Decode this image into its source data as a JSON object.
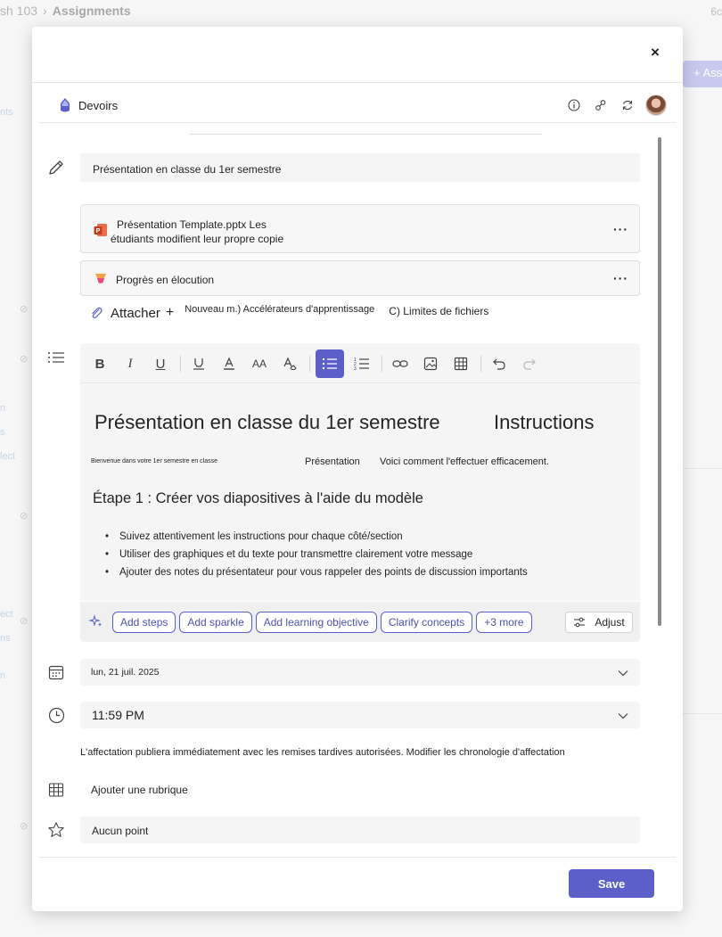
{
  "background": {
    "breadcrumb": [
      "sh 103",
      "Assignments"
    ],
    "top_right": "6c",
    "new_button": "+ Assi",
    "side_labels": [
      "nts",
      "n",
      "s",
      "lect",
      "ect",
      "ns",
      "n"
    ]
  },
  "app_bar": {
    "name": "Devoirs",
    "icons": [
      "info-icon",
      "share-icon",
      "refresh-icon"
    ]
  },
  "title": {
    "value": "Présentation en classe du 1er semestre"
  },
  "attachments": [
    {
      "type": "pptx",
      "line1": "Présentation Template.pptx Les",
      "line2": "étudiants modifient leur propre copie",
      "more": "···"
    },
    {
      "type": "progress",
      "label": "Progrès en élocution",
      "more": "···"
    }
  ],
  "attach_row": {
    "attach": "Attacher",
    "plus": "+",
    "new": "Nouveau m.) Accélérateurs d'apprentissage",
    "limits": "C) Limites de fichiers"
  },
  "editor": {
    "heading": "Présentation en classe du 1er semestre",
    "heading_b": "Instructions",
    "welcome": "Bienvenue dans votre 1er semestre en classe",
    "presentation": "Présentation",
    "voici": "Voici comment l'effectuer efficacement.",
    "step_heading": "Étape 1 : Créer vos diapositives à l'aide du modèle",
    "bullets": [
      "Suivez attentivement les instructions pour chaque côté/section",
      "Utiliser des graphiques et du texte pour transmettre clairement votre message",
      "Ajouter des notes du présentateur pour vous rappeler des points de discussion importants"
    ]
  },
  "ai_chips": [
    "Add steps",
    "Add sparkle",
    "Add learning objective",
    "Clarify concepts",
    "+3 more"
  ],
  "adjust_label": "Adjust",
  "due_date": "lun, 21 juil. 2025",
  "due_time": "11:59 PM",
  "publish_note": "L'affectation publiera immédiatement avec les remises tardives autorisées. Modifier les chronologie d'affectation",
  "rubric_label": "Ajouter une rubrique",
  "points": "Aucun point",
  "save_label": "Save",
  "close_label": "×",
  "colors": {
    "accent": "#5b5fc7",
    "field_bg": "#f5f5f5",
    "ppt": "#c43e1c"
  }
}
